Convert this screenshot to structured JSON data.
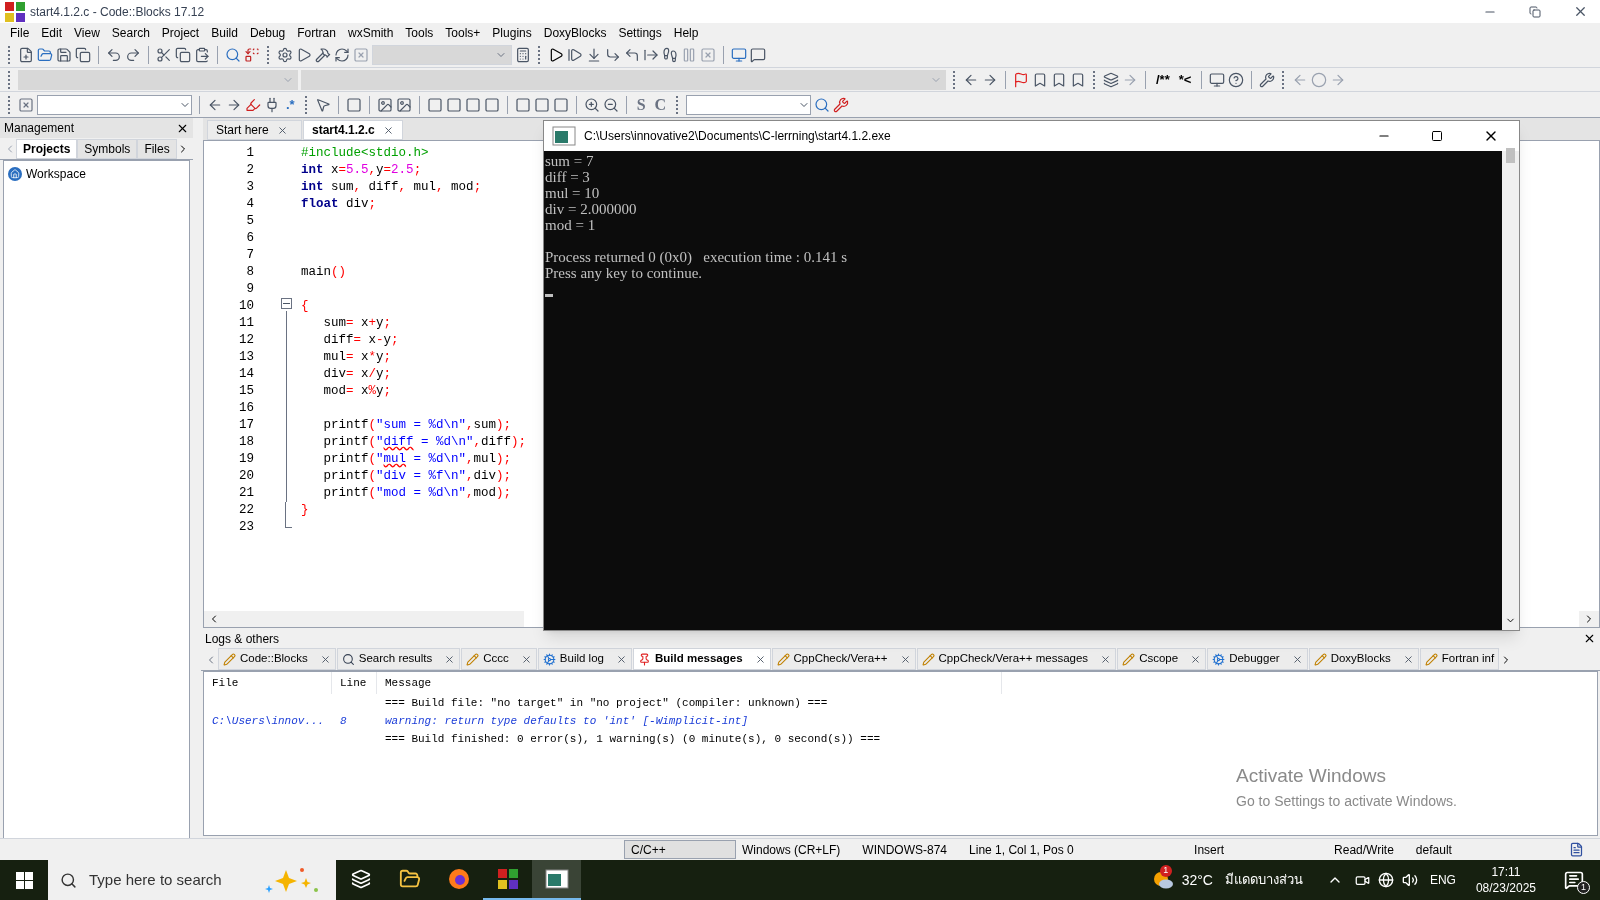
{
  "window": {
    "title": "start4.1.2.c - Code::Blocks 17.12"
  },
  "menu": [
    "File",
    "Edit",
    "View",
    "Search",
    "Project",
    "Build",
    "Debug",
    "Fortran",
    "wxSmith",
    "Tools",
    "Tools+",
    "Plugins",
    "DoxyBlocks",
    "Settings",
    "Help"
  ],
  "toolbar_texts": {
    "regex": ".*",
    "strong": "S",
    "comment": "C",
    "doc_block": "/**",
    "doc_line": "*<"
  },
  "management": {
    "title": "Management",
    "tabs": [
      {
        "label": "Projects",
        "selected": true
      },
      {
        "label": "Symbols",
        "selected": false
      },
      {
        "label": "Files",
        "selected": false
      }
    ],
    "tree": [
      {
        "label": "Workspace"
      }
    ]
  },
  "editor": {
    "tabs": [
      {
        "label": "Start here",
        "selected": false
      },
      {
        "label": "start4.1.2.c",
        "selected": true
      }
    ],
    "lines": [
      {
        "number": "1",
        "kind": "none",
        "tokens": [
          {
            "kind": "preproc",
            "text": "#include<stdio.h>"
          }
        ]
      },
      {
        "number": "2",
        "kind": "none",
        "tokens": [
          {
            "kind": "keyword",
            "text": "int"
          },
          {
            "kind": "plain",
            "text": " x"
          },
          {
            "kind": "op",
            "text": "="
          },
          {
            "kind": "number",
            "text": "5.5"
          },
          {
            "kind": "op",
            "text": ","
          },
          {
            "kind": "plain",
            "text": "y"
          },
          {
            "kind": "op",
            "text": "="
          },
          {
            "kind": "number",
            "text": "2.5"
          },
          {
            "kind": "op",
            "text": ";"
          }
        ]
      },
      {
        "number": "3",
        "kind": "none",
        "tokens": [
          {
            "kind": "keyword",
            "text": "int"
          },
          {
            "kind": "plain",
            "text": " sum"
          },
          {
            "kind": "op",
            "text": ","
          },
          {
            "kind": "plain",
            "text": " diff"
          },
          {
            "kind": "op",
            "text": ","
          },
          {
            "kind": "plain",
            "text": " mul"
          },
          {
            "kind": "op",
            "text": ","
          },
          {
            "kind": "plain",
            "text": " mod"
          },
          {
            "kind": "op",
            "text": ";"
          }
        ]
      },
      {
        "number": "4",
        "kind": "none",
        "tokens": [
          {
            "kind": "keyword",
            "text": "float"
          },
          {
            "kind": "plain",
            "text": " div"
          },
          {
            "kind": "op",
            "text": ";"
          }
        ]
      },
      {
        "number": "5",
        "kind": "none"
      },
      {
        "number": "6",
        "kind": "none"
      },
      {
        "number": "7",
        "kind": "none"
      },
      {
        "number": "8",
        "kind": "none",
        "tokens": [
          {
            "kind": "plain",
            "text": "main"
          },
          {
            "kind": "op",
            "text": "()"
          }
        ]
      },
      {
        "number": "9",
        "kind": "none"
      },
      {
        "number": "10",
        "kind": "start",
        "tokens": [
          {
            "kind": "op",
            "text": "{"
          }
        ]
      },
      {
        "number": "11",
        "kind": "body",
        "tokens": [
          {
            "kind": "plain",
            "text": "   sum"
          },
          {
            "kind": "op",
            "text": "="
          },
          {
            "kind": "plain",
            "text": " x"
          },
          {
            "kind": "op",
            "text": "+"
          },
          {
            "kind": "plain",
            "text": "y"
          },
          {
            "kind": "op",
            "text": ";"
          }
        ]
      },
      {
        "number": "12",
        "kind": "body",
        "tokens": [
          {
            "kind": "plain",
            "text": "   diff"
          },
          {
            "kind": "op",
            "text": "="
          },
          {
            "kind": "plain",
            "text": " x"
          },
          {
            "kind": "op",
            "text": "-"
          },
          {
            "kind": "plain",
            "text": "y"
          },
          {
            "kind": "op",
            "text": ";"
          }
        ]
      },
      {
        "number": "13",
        "kind": "body",
        "tokens": [
          {
            "kind": "plain",
            "text": "   mul"
          },
          {
            "kind": "op",
            "text": "="
          },
          {
            "kind": "plain",
            "text": " x"
          },
          {
            "kind": "op",
            "text": "*"
          },
          {
            "kind": "plain",
            "text": "y"
          },
          {
            "kind": "op",
            "text": ";"
          }
        ]
      },
      {
        "number": "14",
        "kind": "body",
        "tokens": [
          {
            "kind": "plain",
            "text": "   div"
          },
          {
            "kind": "op",
            "text": "="
          },
          {
            "kind": "plain",
            "text": " x"
          },
          {
            "kind": "op",
            "text": "/"
          },
          {
            "kind": "plain",
            "text": "y"
          },
          {
            "kind": "op",
            "text": ";"
          }
        ]
      },
      {
        "number": "15",
        "kind": "body",
        "tokens": [
          {
            "kind": "plain",
            "text": "   mod"
          },
          {
            "kind": "op",
            "text": "="
          },
          {
            "kind": "plain",
            "text": " x"
          },
          {
            "kind": "op",
            "text": "%"
          },
          {
            "kind": "plain",
            "text": "y"
          },
          {
            "kind": "op",
            "text": ";"
          }
        ]
      },
      {
        "number": "16",
        "kind": "body"
      },
      {
        "number": "17",
        "kind": "body",
        "tokens": [
          {
            "kind": "plain",
            "text": "   printf"
          },
          {
            "kind": "op",
            "text": "("
          },
          {
            "kind": "string",
            "text": "\"sum = %d\\n\""
          },
          {
            "kind": "op",
            "text": ","
          },
          {
            "kind": "plain",
            "text": "sum"
          },
          {
            "kind": "op",
            "text": ");"
          }
        ]
      },
      {
        "number": "18",
        "kind": "body",
        "tokens": [
          {
            "kind": "plain",
            "text": "   printf"
          },
          {
            "kind": "op",
            "text": "("
          },
          {
            "kind": "string",
            "text": "\""
          },
          {
            "kind": "misspelt",
            "text": "diff"
          },
          {
            "kind": "string",
            "text": " = %d\\n\""
          },
          {
            "kind": "op",
            "text": ","
          },
          {
            "kind": "plain",
            "text": "diff"
          },
          {
            "kind": "op",
            "text": ");"
          }
        ]
      },
      {
        "number": "19",
        "kind": "body",
        "tokens": [
          {
            "kind": "plain",
            "text": "   printf"
          },
          {
            "kind": "op",
            "text": "("
          },
          {
            "kind": "string",
            "text": "\""
          },
          {
            "kind": "misspelt",
            "text": "mul"
          },
          {
            "kind": "string",
            "text": " = %d\\n\""
          },
          {
            "kind": "op",
            "text": ","
          },
          {
            "kind": "plain",
            "text": "mul"
          },
          {
            "kind": "op",
            "text": ");"
          }
        ]
      },
      {
        "number": "20",
        "kind": "body",
        "tokens": [
          {
            "kind": "plain",
            "text": "   printf"
          },
          {
            "kind": "op",
            "text": "("
          },
          {
            "kind": "string",
            "text": "\"div = %f\\n\""
          },
          {
            "kind": "op",
            "text": ","
          },
          {
            "kind": "plain",
            "text": "div"
          },
          {
            "kind": "op",
            "text": ");"
          }
        ]
      },
      {
        "number": "21",
        "kind": "body",
        "tokens": [
          {
            "kind": "plain",
            "text": "   printf"
          },
          {
            "kind": "op",
            "text": "("
          },
          {
            "kind": "string",
            "text": "\"mod = %d\\n\""
          },
          {
            "kind": "op",
            "text": ","
          },
          {
            "kind": "plain",
            "text": "mod"
          },
          {
            "kind": "op",
            "text": ");"
          }
        ]
      },
      {
        "number": "22",
        "kind": "end",
        "tokens": [
          {
            "kind": "op",
            "text": "}"
          }
        ]
      },
      {
        "number": "23",
        "kind": "none"
      }
    ]
  },
  "console": {
    "title": "C:\\Users\\innovative2\\Documents\\C-lerrning\\start4.1.2.exe",
    "output": [
      "sum = 7",
      "diff = 3",
      "mul = 10",
      "div = 2.000000",
      "mod = 1"
    ],
    "footer": [
      "Process returned 0 (0x0)   execution time : 0.141 s",
      "Press any key to continue."
    ]
  },
  "logs": {
    "title": "Logs & others",
    "tabs": [
      {
        "label": "Code::Blocks",
        "kind": "pencil",
        "selected": false
      },
      {
        "label": "Search results",
        "kind": "search",
        "selected": false
      },
      {
        "label": "Cccc",
        "kind": "pencil",
        "selected": false
      },
      {
        "label": "Build log",
        "kind": "gear",
        "selected": false
      },
      {
        "label": "Build messages",
        "kind": "pin",
        "selected": true
      },
      {
        "label": "CppCheck/Vera++",
        "kind": "pencil",
        "selected": false
      },
      {
        "label": "CppCheck/Vera++ messages",
        "kind": "pencil",
        "selected": false
      },
      {
        "label": "Cscope",
        "kind": "pencil",
        "selected": false
      },
      {
        "label": "Debugger",
        "kind": "gear",
        "selected": false
      },
      {
        "label": "DoxyBlocks",
        "kind": "pencil",
        "selected": false
      },
      {
        "label": "Fortran inf",
        "kind": "pencil",
        "selected": false
      }
    ],
    "columns": [
      "File",
      "Line",
      "Message"
    ],
    "rows": [
      {
        "kind": "info",
        "message": "=== Build file: \"no target\" in \"no project\" (compiler: unknown) ==="
      },
      {
        "kind": "warning",
        "file": "C:\\Users\\innov...",
        "line": "8",
        "message": "warning: return type defaults to 'int' [-Wimplicit-int]"
      },
      {
        "kind": "info",
        "message": "=== Build finished: 0 error(s), 1 warning(s) (0 minute(s), 0 second(s)) ==="
      }
    ]
  },
  "activation": {
    "title": "Activate Windows",
    "subtitle": "Go to Settings to activate Windows."
  },
  "status_bar": [
    "C/C++",
    "Windows (CR+LF)",
    "WINDOWS-874",
    "Line 1, Col 1, Pos 0",
    "Insert",
    "Read/Write",
    "default"
  ],
  "taskbar": {
    "search_placeholder": "Type here to search",
    "apps": [
      {
        "kind": "taskview",
        "running": false
      },
      {
        "kind": "folder",
        "running": false
      },
      {
        "kind": "browser",
        "running": false
      },
      {
        "kind": "codeblocks",
        "running": true
      },
      {
        "kind": "console",
        "running": true
      }
    ],
    "weather": {
      "temperature": "32°C",
      "condition": "มีแดดบางส่วน",
      "badge": "1"
    },
    "language": "ENG",
    "time": "17:11",
    "date": "08/23/2025",
    "notifications": "1"
  }
}
